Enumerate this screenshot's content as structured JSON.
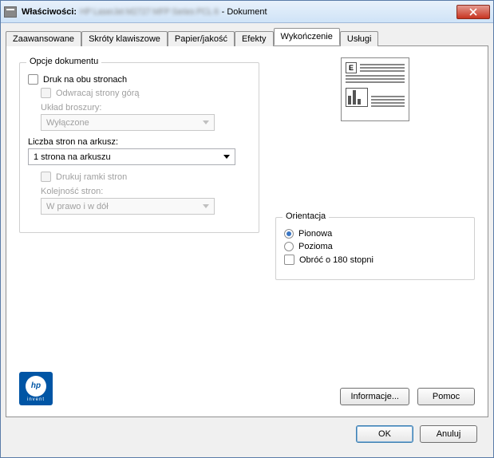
{
  "titlebar": {
    "prefix": "Właściwości:",
    "blurred": "HP LaserJet M2727 MFP Series PCL 6",
    "suffix": "- Dokument"
  },
  "tabs": {
    "zaawansowane": "Zaawansowane",
    "skroty": "Skróty klawiszowe",
    "papier": "Papier/jakość",
    "efekty": "Efekty",
    "wykonczenie": "Wykończenie",
    "uslugi": "Usługi"
  },
  "opcje": {
    "title": "Opcje dokumentu",
    "duplex": "Druk na obu stronach",
    "flip": "Odwracaj strony górą",
    "booklet_label": "Układ broszury:",
    "booklet_value": "Wyłączone",
    "pages_label": "Liczba stron na arkusz:",
    "pages_value": "1 strona na arkuszu",
    "borders": "Drukuj ramki stron",
    "order_label": "Kolejność stron:",
    "order_value": "W prawo i w dół"
  },
  "orientation": {
    "title": "Orientacja",
    "portrait": "Pionowa",
    "landscape": "Pozioma",
    "rotate": "Obróć o 180 stopni"
  },
  "logo": {
    "text": "hp",
    "sub": "invent"
  },
  "buttons": {
    "info": "Informacje...",
    "help": "Pomoc",
    "ok": "OK",
    "cancel": "Anuluj"
  }
}
